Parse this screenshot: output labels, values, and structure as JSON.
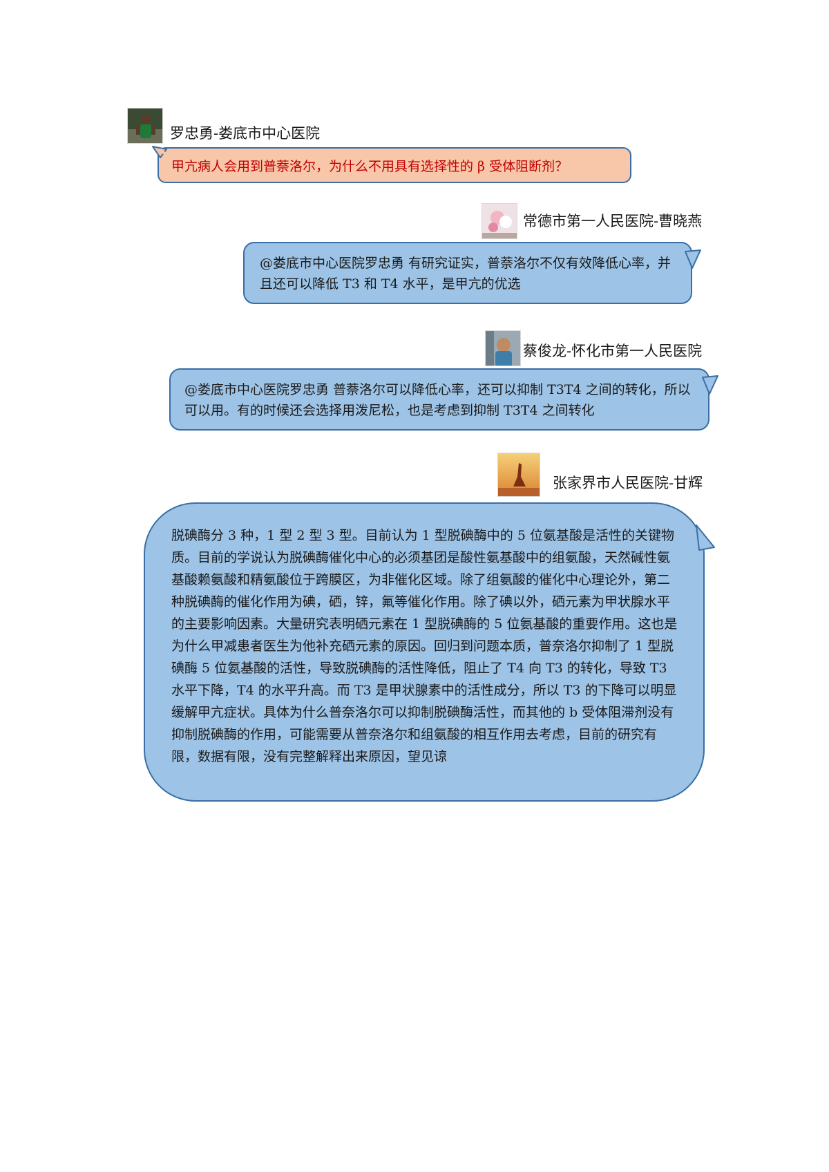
{
  "messages": [
    {
      "author": "罗忠勇-娄底市中心医院",
      "avatar_icon": "person-avatar-icon",
      "text": "甲亢病人会用到普萘洛尔，为什么不用具有选择性的 β 受体阻断剂？",
      "bubble_color": "#f8c6a9",
      "text_color": "#c00000"
    },
    {
      "author": "常德市第一人民医院-曹晓燕",
      "avatar_icon": "plush-toy-avatar-icon",
      "text": "@娄底市中心医院罗忠勇 有研究证实，普萘洛尔不仅有效降低心率，并且还可以降低 T3 和 T4 水平，是甲亢的优选",
      "bubble_color": "#9dc3e6",
      "text_color": "#1a1a1a"
    },
    {
      "author": "蔡俊龙-怀化市第一人民医院",
      "avatar_icon": "person-avatar-icon",
      "text": "@娄底市中心医院罗忠勇 普萘洛尔可以降低心率，还可以抑制 T3T4 之间的转化，所以可以用。有的时候还会选择用泼尼松，也是考虑到抑制 T3T4 之间转化",
      "bubble_color": "#9dc3e6",
      "text_color": "#1a1a1a"
    },
    {
      "author": "张家界市人民医院-甘辉",
      "avatar_icon": "sunset-silhouette-avatar-icon",
      "text": "脱碘酶分 3 种，1 型 2 型 3 型。目前认为 1 型脱碘酶中的 5 位氨基酸是活性的关键物质。目前的学说认为脱碘酶催化中心的必须基团是酸性氨基酸中的组氨酸，天然碱性氨基酸赖氨酸和精氨酸位于跨膜区，为非催化区域。除了组氨酸的催化中心理论外，第二种脱碘酶的催化作用为碘，硒，锌，氟等催化作用。除了碘以外，硒元素为甲状腺水平的主要影响因素。大量研究表明硒元素在 1 型脱碘酶的 5 位氨基酸的重要作用。这也是为什么甲减患者医生为他补充硒元素的原因。回归到问题本质，普奈洛尔抑制了 1 型脱碘酶 5 位氨基酸的活性，导致脱碘酶的活性降低，阻止了 T4 向 T3 的转化，导致 T3 水平下降，T4 的水平升高。而 T3 是甲状腺素中的活性成分，所以 T3 的下降可以明显缓解甲亢症状。具体为什么普奈洛尔可以抑制脱碘酶活性，而其他的 b 受体阻滞剂没有抑制脱碘酶的作用，可能需要从普奈洛尔和组氨酸的相互作用去考虑，目前的研究有限，数据有限，没有完整解释出来原因，望见谅",
      "bubble_color": "#9dc3e6",
      "text_color": "#1a1a1a"
    }
  ]
}
